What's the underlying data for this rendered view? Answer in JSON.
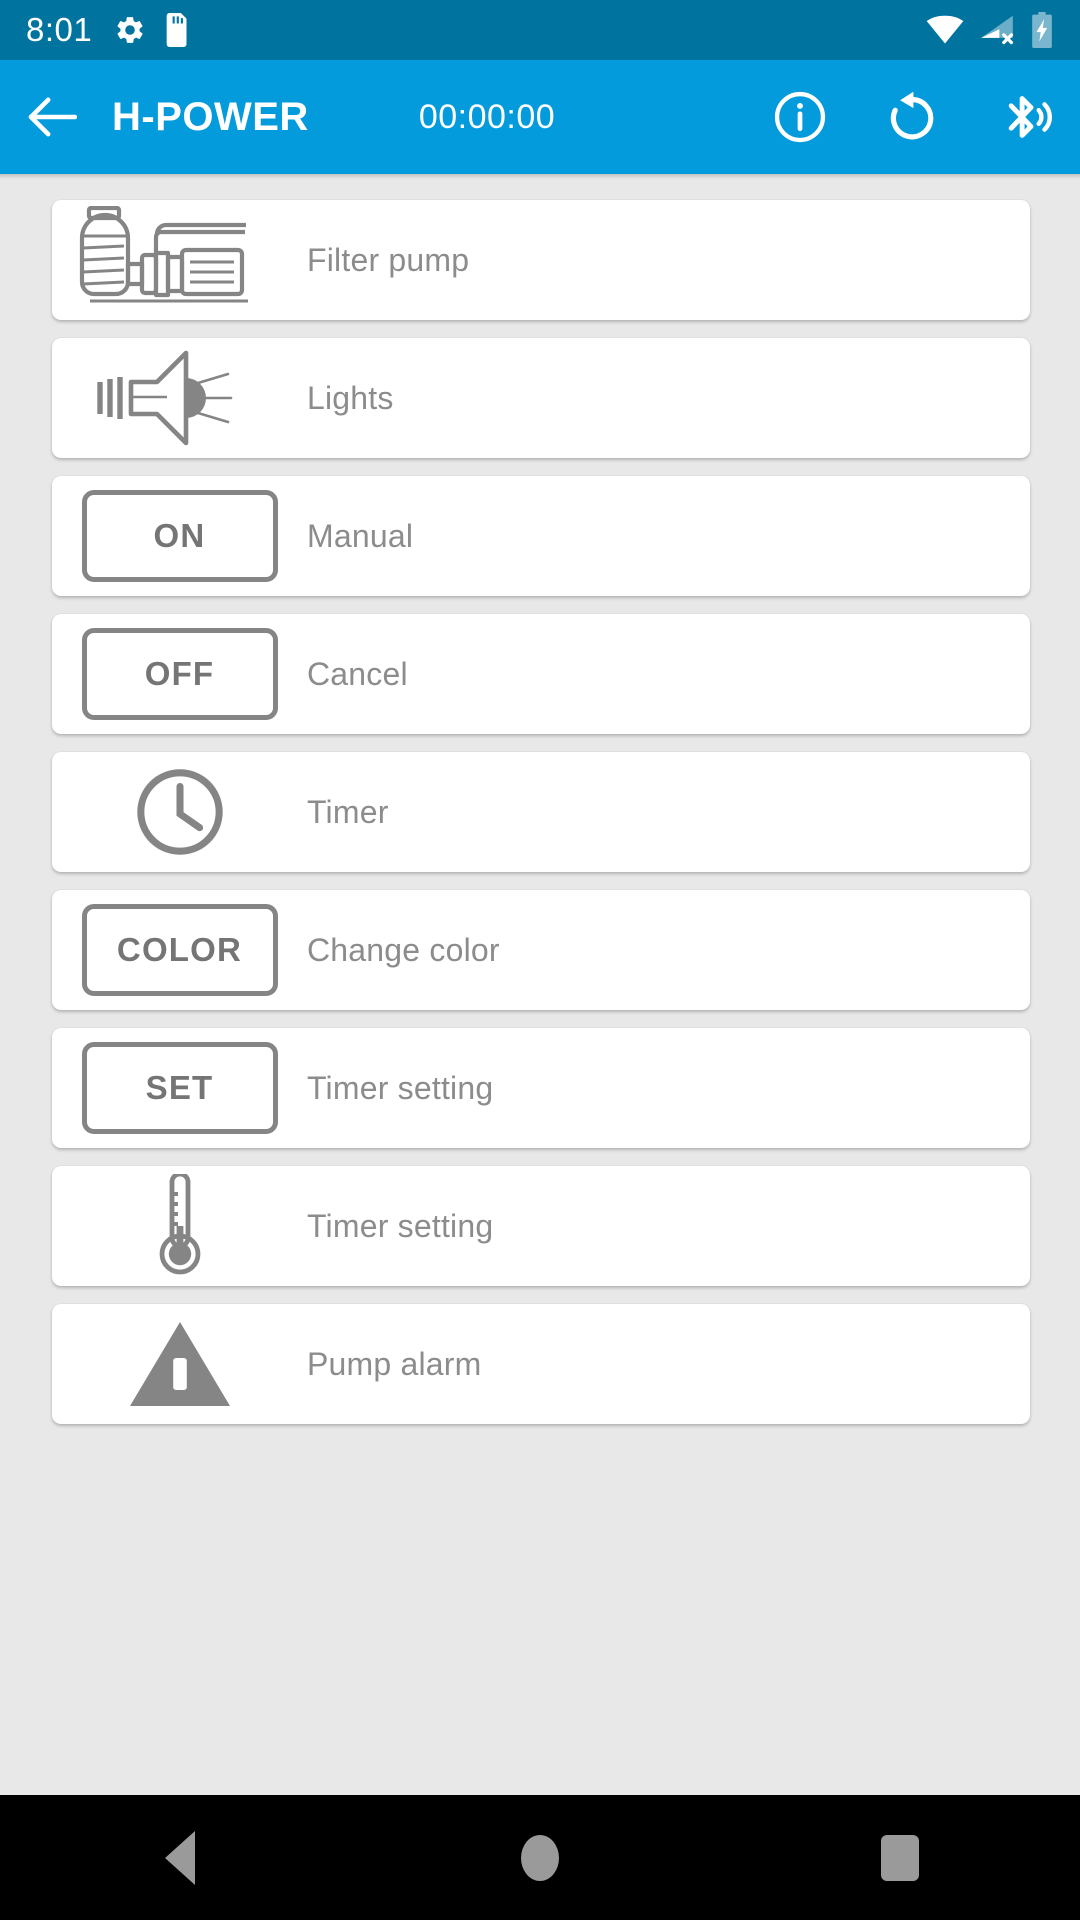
{
  "status_bar": {
    "clock": "8:01",
    "left_icons": [
      "settings-gear-icon",
      "sd-card-icon"
    ],
    "right_icons": [
      "wifi-icon",
      "cellular-no-signal-icon",
      "battery-charging-icon"
    ],
    "background_color": "#00749f"
  },
  "toolbar": {
    "back_label": "back-arrow",
    "title": "H-POWER",
    "timer": "00:00:00",
    "background_color": "#039bdb",
    "actions": [
      {
        "name": "info-icon",
        "label": "Info"
      },
      {
        "name": "reset-rotate-left-icon",
        "label": "Reset"
      },
      {
        "name": "bluetooth-searching-icon",
        "label": "Bluetooth"
      }
    ]
  },
  "list": {
    "rows": [
      {
        "icon": "filter-pump-icon",
        "kind": "graphic",
        "label": "Filter pump"
      },
      {
        "icon": "spotlight-icon",
        "kind": "graphic",
        "label": "Lights"
      },
      {
        "icon": "on-button",
        "kind": "button",
        "button_text": "ON",
        "label": "Manual"
      },
      {
        "icon": "off-button",
        "kind": "button",
        "button_text": "OFF",
        "label": "Cancel"
      },
      {
        "icon": "clock-icon",
        "kind": "graphic",
        "label": "Timer"
      },
      {
        "icon": "color-button",
        "kind": "button",
        "button_text": "COLOR",
        "label": "Change color"
      },
      {
        "icon": "set-button",
        "kind": "button",
        "button_text": "SET",
        "label": "Timer setting"
      },
      {
        "icon": "thermometer-icon",
        "kind": "graphic",
        "label": "Timer setting"
      },
      {
        "icon": "warning-triangle-icon",
        "kind": "graphic",
        "label": "Pump alarm"
      }
    ],
    "icon_color": "#858585",
    "label_color": "#8c8c8c",
    "card_background": "#ffffff",
    "page_background": "#e8e8e8"
  },
  "navigation_bar": {
    "background_color": "#000000",
    "buttons": [
      {
        "name": "nav-back-icon",
        "label": "Back"
      },
      {
        "name": "nav-home-icon",
        "label": "Home"
      },
      {
        "name": "nav-recents-icon",
        "label": "Recents"
      }
    ]
  }
}
